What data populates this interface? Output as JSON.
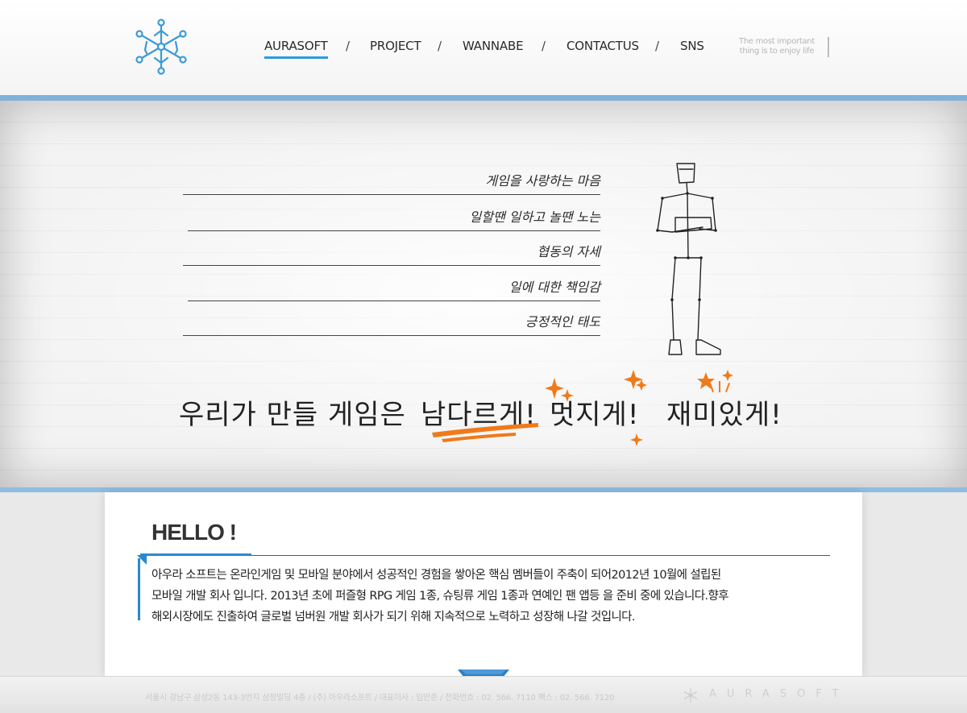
{
  "header": {
    "nav": [
      {
        "label": "AURASOFT",
        "active": true
      },
      {
        "label": "PROJECT",
        "active": false
      },
      {
        "label": "WANNABE",
        "active": false
      },
      {
        "label": "CONTACTUS",
        "active": false
      },
      {
        "label": "SNS",
        "active": false
      }
    ],
    "nav_separator": "/",
    "tagline_line1": "The most important",
    "tagline_line2": "thing is to enjoy life"
  },
  "hero": {
    "mottos": [
      "게임을 사랑하는 마음",
      "일할땐 일하고 놀땐 노는",
      "협동의 자세",
      "일에 대한 책임감",
      "긍정적인 태도"
    ],
    "slogan": {
      "part1": "우리가 만들 게임은",
      "part2": "남다르게!",
      "part3": "멋지게!",
      "part4": "재미있게!"
    }
  },
  "content": {
    "title": "HELLO !",
    "paragraph_lines": [
      " 아우라 소프트는 온라인게임 및 모바일 분야에서 성공적인 경험을 쌓아온 핵심 멤버들이 주축이 되어2012년 10월에 설립된",
      "모바일 개발 회사 입니다. 2013년 초에 퍼즐형 RPG 게임 1종, 슈팅류 게임 1종과 연예인 팬 앱등 을 준비 중에 있습니다.향후",
      "해외시장에도 진출하여 글로벌 넘버원 개발 회사가 되기 위해 지속적으로 노력하고 성장해 나갈 것입니다."
    ]
  },
  "footer": {
    "address": "서울시 강남구 삼성2동 143-3번지 삼정빌딩 4층 / (주) 아우라소프트 / 대표이사 : 임만준 / 전화번호 : 02. 566. 7110 팩스 : 02. 566. 7120",
    "brand": "AURASOFT"
  },
  "colors": {
    "accent_blue": "#2b9be0",
    "hero_border": "#7fb2d8",
    "orange": "#f07a1a"
  }
}
